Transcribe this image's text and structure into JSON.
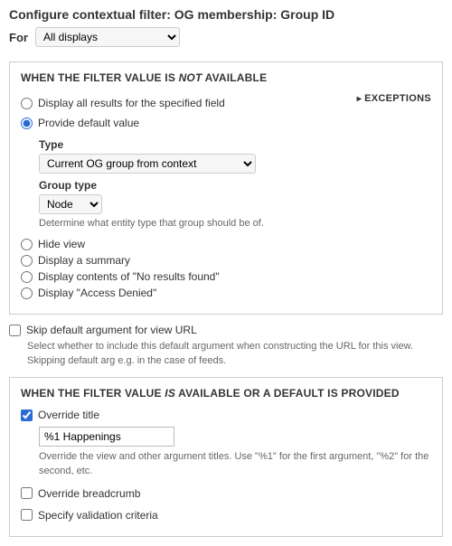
{
  "header": {
    "title": "Configure contextual filter: OG membership: Group ID",
    "for_label": "For",
    "for_value": "All displays"
  },
  "fieldset_not_available": {
    "heading_prefix": "WHEN THE FILTER VALUE IS ",
    "heading_em": "NOT",
    "heading_suffix": " AVAILABLE",
    "exceptions_link": "EXCEPTIONS",
    "radios": {
      "display_all": "Display all results for the specified field",
      "provide_default": "Provide default value",
      "hide_view": "Hide view",
      "display_summary": "Display a summary",
      "display_no_results": "Display contents of \"No results found\"",
      "display_access_denied": "Display \"Access Denied\""
    },
    "default_value": {
      "type_label": "Type",
      "type_value": "Current OG group from context",
      "group_type_label": "Group type",
      "group_type_value": "Node",
      "group_type_desc": "Determine what entity type that group should be of."
    }
  },
  "middle": {
    "skip_default_label": "Skip default argument for view URL",
    "skip_default_desc": "Select whether to include this default argument when constructing the URL for this view. Skipping default arg e.g. in the case of feeds."
  },
  "fieldset_available": {
    "heading_prefix": "WHEN THE FILTER VALUE ",
    "heading_em": "IS",
    "heading_suffix": " AVAILABLE OR A DEFAULT IS PROVIDED",
    "override_title_label": "Override title",
    "override_title_value": "%1 Happenings",
    "override_title_desc": "Override the view and other argument titles. Use \"%1\" for the first argument, \"%2\" for the second, etc.",
    "override_breadcrumb_label": "Override breadcrumb",
    "specify_validation_label": "Specify validation criteria"
  }
}
